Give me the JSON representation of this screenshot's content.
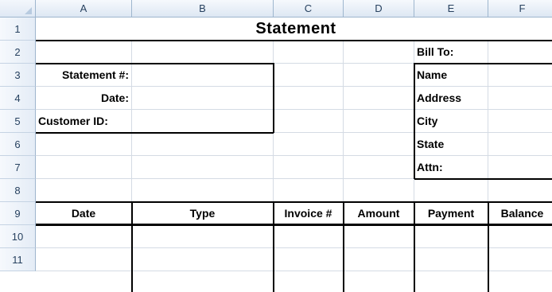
{
  "columns": [
    "A",
    "B",
    "C",
    "D",
    "E",
    "F"
  ],
  "rows": [
    "1",
    "2",
    "3",
    "4",
    "5",
    "6",
    "7",
    "8",
    "9",
    "10",
    "11"
  ],
  "sheet": {
    "title": "Statement",
    "bill_to": "Bill To:",
    "statement_no_label": "Statement #:",
    "date_label": "Date:",
    "customer_id_label": "Customer ID:",
    "name_label": "Name",
    "address_label": "Address",
    "city_label": "City",
    "state_label": "State",
    "attn_label": "Attn:",
    "table_headers": {
      "date": "Date",
      "type": "Type",
      "invoice": "Invoice #",
      "amount": "Amount",
      "payment": "Payment",
      "balance": "Balance"
    }
  }
}
